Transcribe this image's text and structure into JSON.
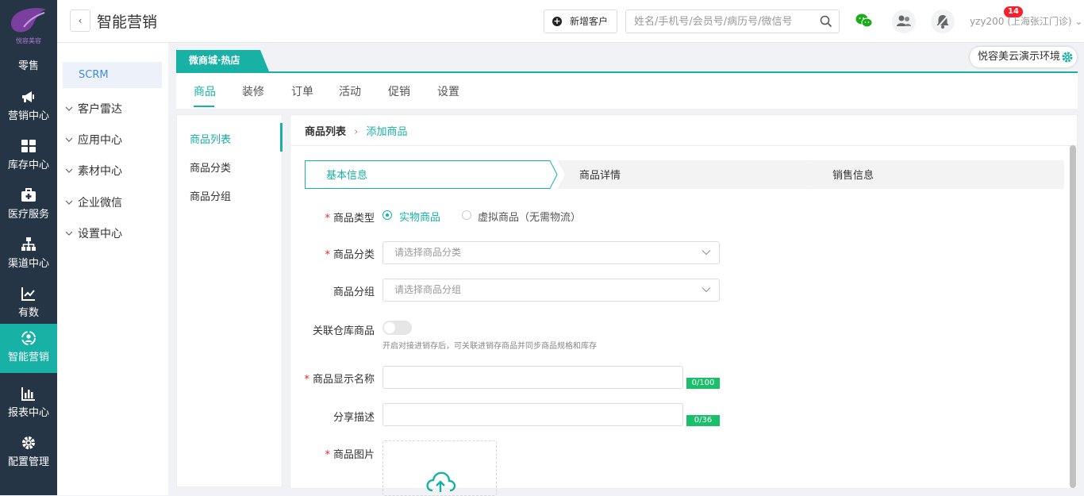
{
  "app": {
    "title": "智能营销",
    "logo_text": "悦容美容"
  },
  "rail": [
    {
      "label": "零售",
      "icon": "shop-icon"
    },
    {
      "label": "营销中心",
      "icon": "megaphone-icon"
    },
    {
      "label": "库存中心",
      "icon": "grid-icon"
    },
    {
      "label": "医疗服务",
      "icon": "medical-kit-icon"
    },
    {
      "label": "渠道中心",
      "icon": "org-chart-icon"
    },
    {
      "label": "有数",
      "icon": "trend-icon"
    },
    {
      "label": "智能营销",
      "icon": "smart-marketing-icon",
      "active": true
    },
    {
      "label": "报表中心",
      "icon": "bar-chart-icon"
    },
    {
      "label": "配置管理",
      "icon": "gear-icon"
    }
  ],
  "topbar": {
    "add_customer": "新增客户",
    "search_placeholder": "姓名/手机号/会员号/病历号/微信号",
    "notification_count": "14",
    "user": "yzy200 (上海张江门诊)"
  },
  "side2": {
    "active": "SCRM",
    "items": [
      "客户雷达",
      "应用中心",
      "素材中心",
      "企业微信",
      "设置中心"
    ]
  },
  "store_tab": "微商城·热店",
  "env_label": "悦容美云演示环境",
  "main_tabs": [
    "商品",
    "装修",
    "订单",
    "活动",
    "促销",
    "设置"
  ],
  "sub_menu": [
    "商品列表",
    "商品分类",
    "商品分组"
  ],
  "breadcrumb": {
    "parent": "商品列表",
    "current": "添加商品"
  },
  "steps": [
    "基本信息",
    "商品详情",
    "销售信息"
  ],
  "form": {
    "type_label": "商品类型",
    "type_options": [
      "实物商品",
      "虚拟商品（无需物流）"
    ],
    "category_label": "商品分类",
    "category_placeholder": "请选择商品分类",
    "group_label": "商品分组",
    "group_placeholder": "请选择商品分组",
    "warehouse_label": "关联仓库商品",
    "warehouse_hint": "开启对接进销存后，可关联进销存商品并同步商品规格和库存",
    "name_label": "商品显示名称",
    "name_counter": "0/100",
    "share_label": "分享描述",
    "share_counter": "0/36",
    "image_label": "商品图片"
  },
  "colors": {
    "accent": "#18b1a6",
    "rail_bg": "#263546",
    "counter": "#1abe6b",
    "badge": "#f5222d"
  }
}
